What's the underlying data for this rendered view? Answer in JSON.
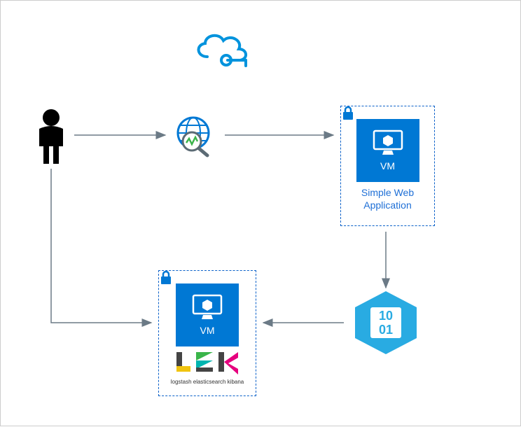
{
  "nodes": {
    "user": {
      "name": "User"
    },
    "cloud": {
      "name": "Azure Cloud"
    },
    "monitor": {
      "name": "Web Monitoring / Search"
    },
    "vm1": {
      "label": "VM",
      "caption": "Simple Web Application"
    },
    "vm2": {
      "label": "VM",
      "lek_caption": "logstash elasticsearch kibana"
    },
    "datastore": {
      "name": "Binary Data Store",
      "display": [
        "10",
        "01"
      ]
    }
  },
  "arrows": [
    {
      "from": "user",
      "to": "monitor"
    },
    {
      "from": "monitor",
      "to": "vm1"
    },
    {
      "from": "vm1",
      "to": "datastore"
    },
    {
      "from": "datastore",
      "to": "vm2"
    },
    {
      "from": "user",
      "to": "vm2"
    }
  ]
}
